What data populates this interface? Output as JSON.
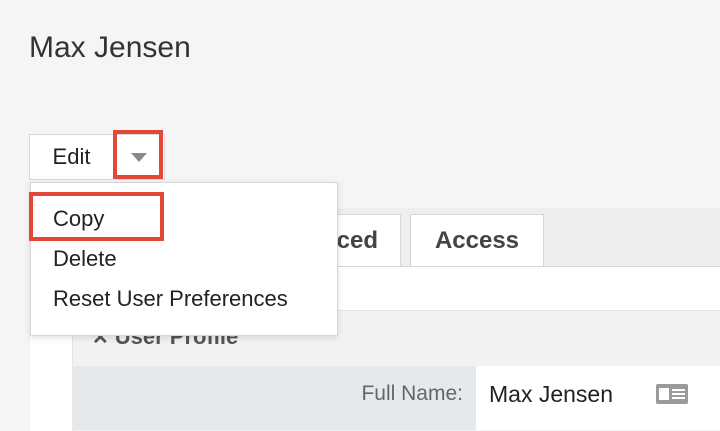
{
  "page": {
    "title": "Max Jensen"
  },
  "actions": {
    "edit_label": "Edit",
    "menu": [
      {
        "label": "Copy"
      },
      {
        "label": "Delete"
      },
      {
        "label": "Reset User Preferences"
      }
    ]
  },
  "tabs": [
    {
      "label": "ced"
    },
    {
      "label": "Access"
    }
  ],
  "panel": {
    "section_title": "User Profile"
  },
  "fields": {
    "full_name_label": "Full Name:",
    "full_name_value": "Max Jensen"
  },
  "colors": {
    "highlight": "#e2483a",
    "caret": "#8a8a8a"
  },
  "icons": {
    "caret": "chevron-down-icon",
    "card": "id-card-icon",
    "collapse": "collapse-icon"
  }
}
